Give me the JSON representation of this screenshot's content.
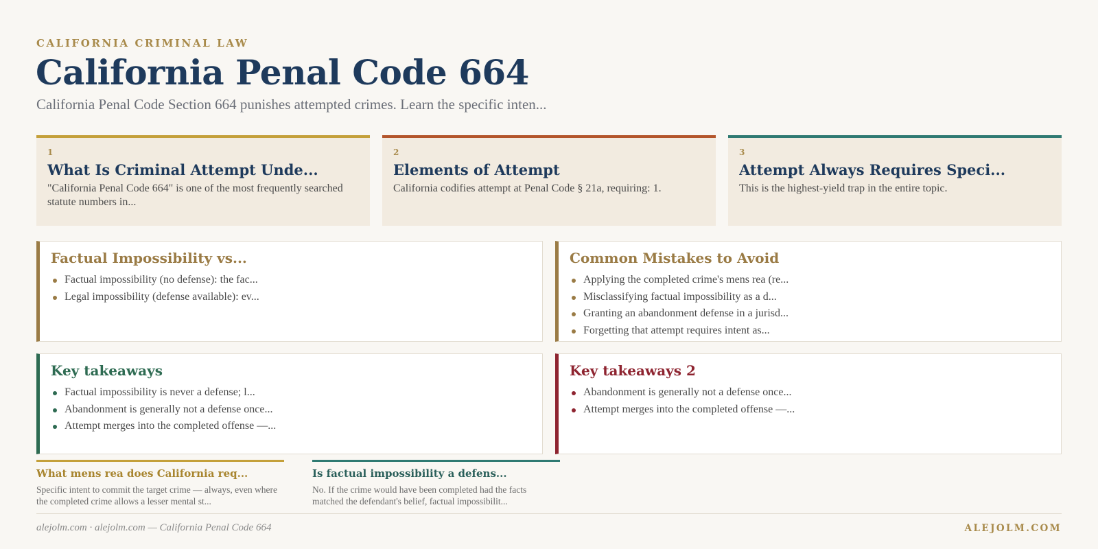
{
  "header": {
    "eyebrow": "CALIFORNIA CRIMINAL LAW",
    "title": "California Penal Code 664",
    "subtitle": "California Penal Code Section 664 punishes attempted crimes. Learn the specific inten..."
  },
  "steps": [
    {
      "num": "1",
      "title": "What Is Criminal Attempt Unde...",
      "body": "\"California Penal Code 664\" is one of the most frequently searched statute numbers in...",
      "accent": "#c4a03a"
    },
    {
      "num": "2",
      "title": "Elements of Attempt",
      "body": "California codifies attempt at Penal Code § 21a, requiring: 1.",
      "accent": "#b3552b"
    },
    {
      "num": "3",
      "title": "Attempt Always Requires Speci...",
      "body": "This is the highest-yield trap in the entire topic.",
      "accent": "#2f7a72"
    }
  ],
  "panels": {
    "impossibility": {
      "title": "Factual Impossibility vs...",
      "accent": "#9a7b45",
      "items": [
        "Factual impossibility (no defense): the fac...",
        "Legal impossibility (defense available): ev..."
      ]
    },
    "mistakes": {
      "title": "Common Mistakes to Avoid",
      "accent": "#9a7b45",
      "items": [
        "Applying the completed crime's mens rea (re...",
        "Misclassifying factual impossibility as a d...",
        "Granting an abandonment defense in a jurisd...",
        "Forgetting that attempt requires intent as..."
      ]
    },
    "takeaways": {
      "title": "Key takeaways",
      "accent": "#2e6b52",
      "items": [
        "Factual impossibility is never a defense; l...",
        "Abandonment is generally not a defense once...",
        "Attempt merges into the completed offense —..."
      ]
    },
    "takeaways2": {
      "title": "Key takeaways 2",
      "accent": "#8e2430",
      "items": [
        "Abandonment is generally not a defense once...",
        "Attempt merges into the completed offense —..."
      ]
    }
  },
  "faqs": [
    {
      "q": "What mens rea does California req...",
      "a": "Specific intent to commit the target crime — always, even where the completed crime allows a lesser mental st...",
      "accent": "#c4a03a",
      "qcolor": "#a8852f"
    },
    {
      "q": "Is factual impossibility a defens...",
      "a": "No. If the crime would have been completed had the facts matched the defendant's belief, factual impossibilit...",
      "accent": "#2f7a72",
      "qcolor": "#2a5f5a"
    }
  ],
  "footer": {
    "left": "alejolm.com · alejolm.com — California Penal Code 664",
    "right": "ALEJOLM.COM"
  }
}
